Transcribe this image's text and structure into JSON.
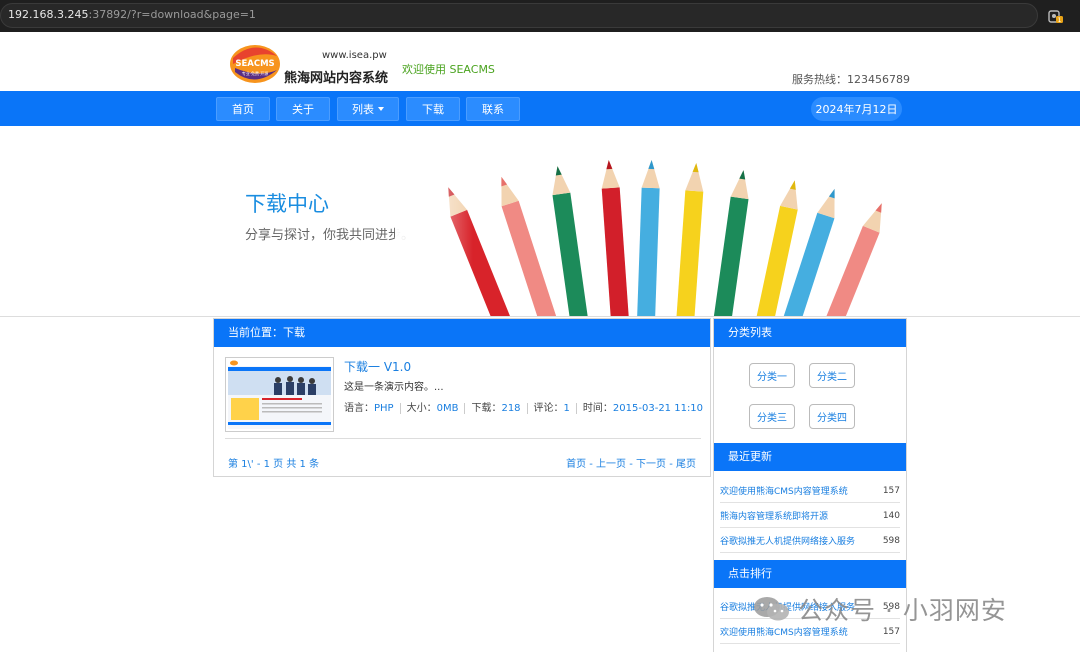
{
  "browser": {
    "url_host": "192.168.3.245",
    "url_rest": ":37892/?r=download&page=1"
  },
  "header": {
    "logo_text": "SEACMS",
    "logo_tagline": "专业·免费·开源",
    "site_url": "www.isea.pw",
    "site_name": "熊海网站内容系统",
    "welcome": "欢迎使用 SEACMS",
    "hotline": "服务热线：123456789"
  },
  "nav": {
    "items": [
      {
        "label": "首页"
      },
      {
        "label": "关于"
      },
      {
        "label": "列表"
      },
      {
        "label": "下载"
      },
      {
        "label": "联系"
      }
    ],
    "date": "2024年7月12日"
  },
  "banner": {
    "title": "下载中心",
    "subtitle": "分享与探讨，你我共同进步。"
  },
  "main": {
    "breadcrumb": "当前位置：下载",
    "item": {
      "title": "下载一 V1.0",
      "desc": "这是一条演示内容。...",
      "lang_label": "语言：",
      "lang": "PHP",
      "size_label": "大小：",
      "size": "0MB",
      "downloads_label": "下载：",
      "downloads": "218",
      "comments_label": "评论：",
      "comments": "1",
      "time_label": "时间：",
      "time": "2015-03-21 11:10"
    },
    "page_info": "第 1\\' - 1 页 共 1 条",
    "pager": "首页 - 上一页 - 下一页 - 尾页"
  },
  "sidebar": {
    "categories_title": "分类列表",
    "categories": [
      "分类一",
      "分类二",
      "分类三",
      "分类四"
    ],
    "recent_title": "最近更新",
    "recent": [
      {
        "title": "欢迎使用熊海CMS内容管理系统",
        "count": "157"
      },
      {
        "title": "熊海内容管理系统即将开源",
        "count": "140"
      },
      {
        "title": "谷歌拟推无人机提供网络接入服务",
        "count": "598"
      }
    ],
    "rank_title": "点击排行",
    "rank": [
      {
        "title": "谷歌拟推无人机提供网络接入服务",
        "count": "598"
      },
      {
        "title": "欢迎使用熊海CMS内容管理系统",
        "count": "157"
      }
    ]
  },
  "watermark": "公众号 · 小羽网安",
  "colors": {
    "brand_blue": "#0a75f8",
    "link_blue": "#1a7fe0",
    "welcome_green": "#4aa31f"
  }
}
